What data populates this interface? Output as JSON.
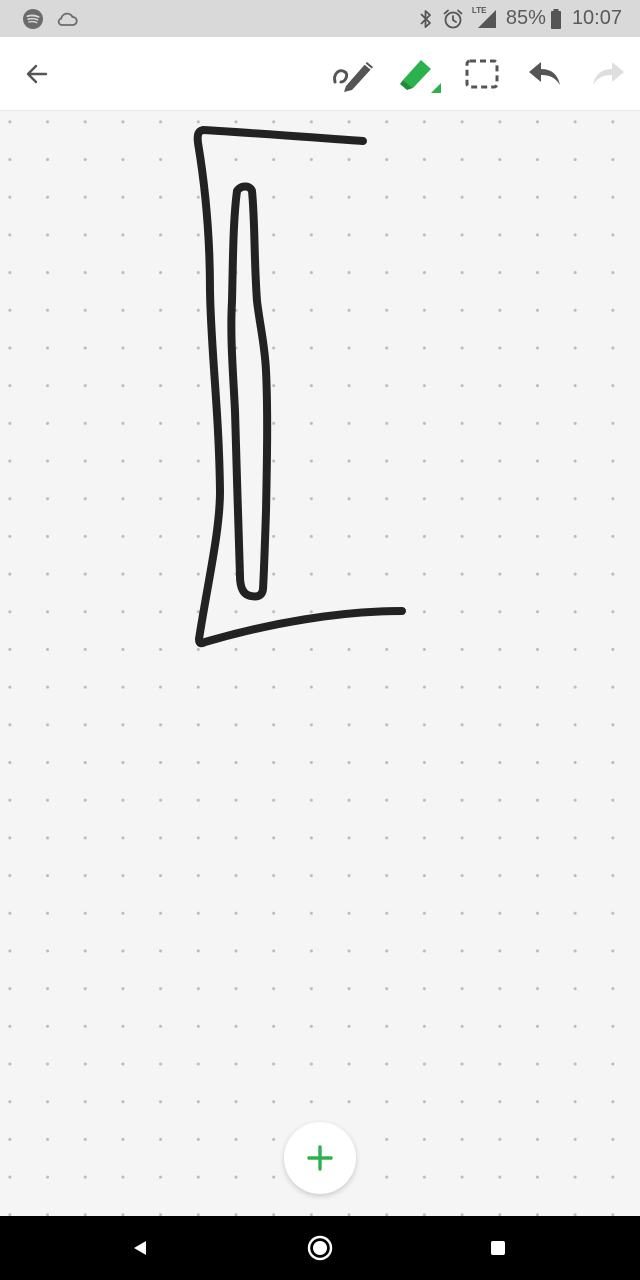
{
  "status_bar": {
    "left_icons": [
      "spotify-icon",
      "cloud-icon"
    ],
    "right_icons": [
      "bluetooth-icon",
      "alarm-icon",
      "lte-signal-icon",
      "battery-icon"
    ],
    "network_label": "LTE",
    "battery_percent": "85%",
    "time": "10:07"
  },
  "toolbar": {
    "back_icon": "arrow-back-icon",
    "tools": [
      {
        "name": "pen-tool",
        "icon": "pen-icon"
      },
      {
        "name": "highlighter-tool",
        "icon": "highlighter-icon",
        "active": true
      },
      {
        "name": "lasso-select-tool",
        "icon": "dashed-select-icon"
      },
      {
        "name": "undo",
        "icon": "undo-icon",
        "enabled": true
      },
      {
        "name": "redo",
        "icon": "redo-icon",
        "enabled": false
      }
    ]
  },
  "canvas": {
    "background": "dot-grid",
    "ink_color": "#222222"
  },
  "fab": {
    "icon": "plus-icon",
    "color": "#2bb24c",
    "label": "+"
  },
  "nav_bar": {
    "buttons": [
      "back-triangle-icon",
      "home-circle-icon",
      "recents-square-icon"
    ]
  },
  "colors": {
    "accent": "#2bb24c",
    "toolbar_bg": "#ffffff",
    "canvas_bg": "#f5f5f5",
    "status_bg": "#d9d9d9",
    "nav_bg": "#000000"
  }
}
